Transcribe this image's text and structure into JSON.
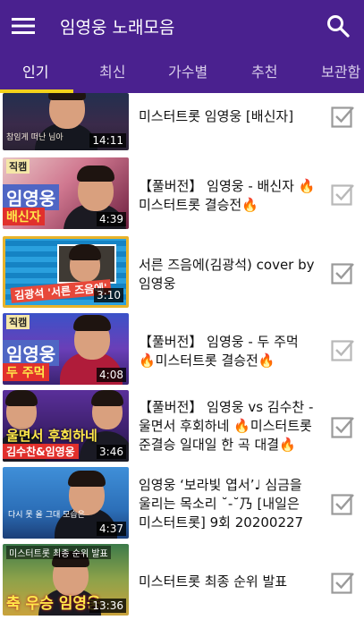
{
  "appbar": {
    "title": "임영웅 노래모음",
    "menu_icon": "hamburger-menu-icon",
    "search_icon": "search-icon",
    "background": "#4a218f"
  },
  "tabs": [
    {
      "label": "인기",
      "active": true
    },
    {
      "label": "최신",
      "active": false
    },
    {
      "label": "가수별",
      "active": false
    },
    {
      "label": "추천",
      "active": false
    },
    {
      "label": "보관함",
      "active": false
    }
  ],
  "accent": "#f2d21c",
  "videos": [
    {
      "title": "미스터트롯 임영웅 [배신자]",
      "duration": "14:11",
      "thumb_text": "참임게 떠난 님아",
      "checked": false
    },
    {
      "title": "【풀버전】 임영웅 - 배신자 🔥미스터트롯 결승전🔥",
      "duration": "4:39",
      "thumb_tag": "직캠",
      "thumb_caption": "임영웅",
      "thumb_subcaption": "배신자",
      "checked": false
    },
    {
      "title": "서른 즈음에(김광석) cover by 임영웅",
      "duration": "3:10",
      "thumb_caption": "김광석 '서른 즈음에'",
      "checked": false
    },
    {
      "title": "【풀버전】 임영웅 - 두 주먹 🔥미스터트롯 결승전🔥",
      "duration": "4:08",
      "thumb_tag": "직캠",
      "thumb_caption": "임영웅",
      "thumb_subcaption": "두 주먹",
      "checked": false
    },
    {
      "title": "【풀버전】 임영웅 vs 김수찬 - 울면서 후회하네 🔥미스터트롯 준결승 일대일 한 곡 대결🔥",
      "duration": "3:46",
      "thumb_caption": "울면서 후회하네",
      "thumb_subcaption": "김수찬&임영웅",
      "checked": false
    },
    {
      "title": "임영웅 ‘보라빛 엽서’♩ 심금을 울리는 목소리 ˘-˘乃 [내일은 미스터트롯] 9회 20200227",
      "duration": "4:37",
      "thumb_text": "다시 못 올 그대 모습은",
      "checked": false
    },
    {
      "title": "미스터트롯 최종 순위 발표",
      "duration": "13:36",
      "thumb_tag": "미스터트롯 최종 순위 발표",
      "thumb_caption": "축 우승 임영웅",
      "checked": false
    }
  ]
}
